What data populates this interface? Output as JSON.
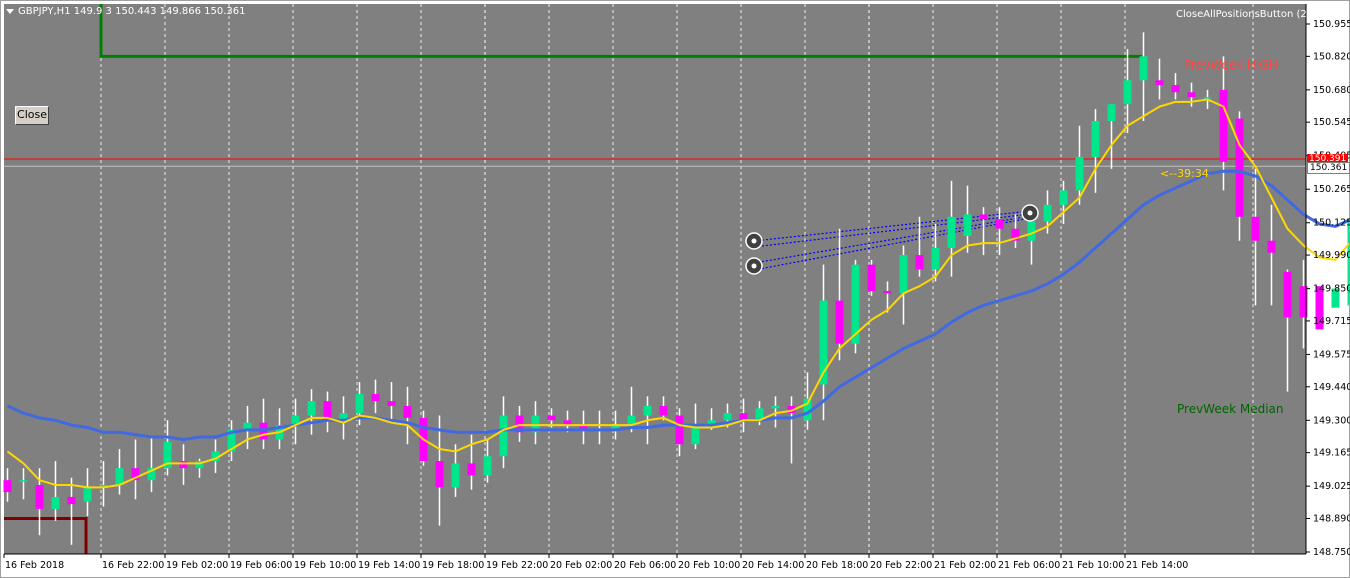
{
  "symbol_header": "GBPJPY,H1  149.9 3 150.443 149.866 150.361",
  "close_button": "Close",
  "close_all_button": "CloseAllPositionsButton (2)",
  "smiley_icon": "smiley-icon",
  "prev_week_high_label": "PrevWeek HIGH",
  "prev_week_median_label": "PrevWeek Median",
  "countdown_label": "<--39:34",
  "current_price_label": "150.361",
  "red_line_price_label": "150.391",
  "colors": {
    "background": "#808080",
    "bull": "#00e68c",
    "bear": "#ff00ff",
    "ma_fast": "#ffd700",
    "ma_slow": "#4169e1",
    "prev_high_line": "#008000",
    "prev_low_line": "#800000",
    "red_line": "#ff0000",
    "current_line": "#c0c0c0",
    "trend_lines": "#0000ff",
    "prev_high_text": "#ff4444",
    "median_text": "#006400",
    "countdown_text": "#ffd700"
  },
  "chart_data": {
    "type": "candlestick",
    "y_ticks": [
      "150.955",
      "150.820",
      "150.680",
      "150.545",
      "150.405",
      "150.265",
      "150.125",
      "149.990",
      "149.850",
      "149.715",
      "149.575",
      "149.440",
      "149.300",
      "149.165",
      "149.025",
      "148.890",
      "148.750"
    ],
    "x_ticks": [
      "16 Feb 2018",
      "16 Feb 22:00",
      "19 Feb 02:00",
      "19 Feb 06:00",
      "19 Feb 10:00",
      "19 Feb 14:00",
      "19 Feb 18:00",
      "19 Feb 22:00",
      "20 Feb 02:00",
      "20 Feb 06:00",
      "20 Feb 10:00",
      "20 Feb 14:00",
      "20 Feb 18:00",
      "20 Feb 22:00",
      "21 Feb 02:00",
      "21 Feb 06:00",
      "21 Feb 10:00",
      "21 Feb 14:00"
    ],
    "ylim": [
      148.75,
      150.98
    ],
    "prev_week_high": 150.82,
    "prev_week_low": 148.89,
    "red_line": 150.391,
    "current_price": 150.361,
    "candles": [
      [
        149.05,
        149.1,
        148.96,
        149.0
      ],
      [
        149.05,
        149.1,
        148.97,
        149.05
      ],
      [
        149.03,
        149.1,
        148.82,
        148.93
      ],
      [
        148.93,
        149.13,
        148.88,
        148.98
      ],
      [
        148.98,
        149.06,
        148.78,
        148.95
      ],
      [
        148.96,
        149.1,
        148.9,
        149.02
      ],
      [
        149.02,
        149.13,
        148.94,
        149.03
      ],
      [
        149.03,
        149.18,
        148.99,
        149.1
      ],
      [
        149.1,
        149.22,
        148.97,
        149.05
      ],
      [
        149.05,
        149.23,
        149.0,
        149.1
      ],
      [
        149.1,
        149.3,
        149.07,
        149.21
      ],
      [
        149.13,
        149.2,
        149.03,
        149.1
      ],
      [
        149.1,
        149.14,
        149.06,
        149.13
      ],
      [
        149.13,
        149.22,
        149.08,
        149.17
      ],
      [
        149.17,
        149.3,
        149.13,
        149.26
      ],
      [
        149.26,
        149.36,
        149.18,
        149.29
      ],
      [
        149.29,
        149.39,
        149.18,
        149.22
      ],
      [
        149.22,
        149.35,
        149.18,
        149.28
      ],
      [
        149.28,
        149.39,
        149.2,
        149.32
      ],
      [
        149.32,
        149.43,
        149.24,
        149.38
      ],
      [
        149.38,
        149.42,
        149.25,
        149.3
      ],
      [
        149.3,
        149.4,
        149.22,
        149.33
      ],
      [
        149.33,
        149.46,
        149.28,
        149.41
      ],
      [
        149.41,
        149.47,
        149.33,
        149.38
      ],
      [
        149.38,
        149.46,
        149.3,
        149.36
      ],
      [
        149.36,
        149.44,
        149.2,
        149.31
      ],
      [
        149.31,
        149.34,
        149.11,
        149.13
      ],
      [
        149.13,
        149.32,
        148.86,
        149.02
      ],
      [
        149.02,
        149.2,
        148.98,
        149.12
      ],
      [
        149.12,
        149.24,
        149.01,
        149.07
      ],
      [
        149.07,
        149.22,
        149.04,
        149.15
      ],
      [
        149.15,
        149.4,
        149.1,
        149.32
      ],
      [
        149.32,
        149.36,
        149.21,
        149.25
      ],
      [
        149.25,
        149.38,
        149.2,
        149.32
      ],
      [
        149.32,
        149.35,
        149.27,
        149.3
      ],
      [
        149.3,
        149.34,
        149.25,
        149.28
      ],
      [
        149.28,
        149.34,
        149.2,
        149.26
      ],
      [
        149.26,
        149.34,
        149.2,
        149.26
      ],
      [
        149.26,
        149.34,
        149.22,
        149.28
      ],
      [
        149.28,
        149.44,
        149.25,
        149.32
      ],
      [
        149.32,
        149.4,
        149.2,
        149.36
      ],
      [
        149.36,
        149.4,
        149.3,
        149.32
      ],
      [
        149.32,
        149.35,
        149.15,
        149.2
      ],
      [
        149.2,
        149.37,
        149.18,
        149.27
      ],
      [
        149.27,
        149.35,
        149.26,
        149.3
      ],
      [
        149.3,
        149.37,
        149.27,
        149.33
      ],
      [
        149.33,
        149.39,
        149.25,
        149.3
      ],
      [
        149.3,
        149.38,
        149.28,
        149.35
      ],
      [
        149.35,
        149.4,
        149.27,
        149.36
      ],
      [
        149.36,
        149.4,
        149.12,
        149.33
      ],
      [
        149.3,
        149.5,
        149.26,
        149.39
      ],
      [
        149.45,
        149.95,
        149.3,
        149.8
      ],
      [
        149.8,
        150.1,
        149.55,
        149.62
      ],
      [
        149.62,
        149.97,
        149.58,
        149.95
      ],
      [
        149.95,
        149.97,
        149.82,
        149.84
      ],
      [
        149.84,
        149.88,
        149.75,
        149.83
      ],
      [
        149.83,
        150.03,
        149.7,
        149.99
      ],
      [
        149.99,
        150.15,
        149.9,
        149.93
      ],
      [
        149.93,
        150.12,
        149.88,
        150.02
      ],
      [
        150.02,
        150.3,
        149.9,
        150.15
      ],
      [
        150.07,
        150.28,
        150.0,
        150.16
      ],
      [
        150.16,
        150.19,
        149.99,
        150.14
      ],
      [
        150.14,
        150.19,
        149.99,
        150.1
      ],
      [
        150.1,
        150.16,
        150.02,
        150.05
      ],
      [
        150.05,
        150.18,
        149.95,
        150.13
      ],
      [
        150.13,
        150.26,
        150.08,
        150.2
      ],
      [
        150.2,
        150.3,
        150.12,
        150.26
      ],
      [
        150.26,
        150.53,
        150.2,
        150.4
      ],
      [
        150.4,
        150.6,
        150.25,
        150.55
      ],
      [
        150.55,
        150.62,
        150.35,
        150.62
      ],
      [
        150.62,
        150.85,
        150.5,
        150.72
      ],
      [
        150.72,
        150.92,
        150.55,
        150.82
      ],
      [
        150.72,
        150.81,
        150.64,
        150.7
      ],
      [
        150.7,
        150.75,
        150.64,
        150.67
      ],
      [
        150.67,
        150.71,
        150.61,
        150.65
      ],
      [
        150.65,
        150.68,
        150.6,
        150.65
      ],
      [
        150.68,
        150.82,
        150.26,
        150.38
      ],
      [
        150.56,
        150.59,
        150.05,
        150.15
      ],
      [
        150.15,
        150.35,
        149.78,
        150.05
      ],
      [
        150.05,
        150.2,
        149.78,
        150.0
      ],
      [
        149.92,
        149.93,
        149.42,
        149.73
      ],
      [
        149.86,
        149.97,
        149.6,
        149.73
      ],
      [
        149.86,
        149.89,
        149.6,
        149.68
      ],
      [
        149.77,
        149.9,
        149.65,
        149.85
      ],
      [
        149.78,
        150.4,
        149.68,
        150.14
      ]
    ],
    "ma_fast": [
      149.17,
      149.12,
      149.05,
      149.03,
      149.03,
      149.02,
      149.02,
      149.03,
      149.06,
      149.09,
      149.12,
      149.12,
      149.12,
      149.14,
      149.18,
      149.22,
      149.24,
      149.25,
      149.28,
      149.31,
      149.31,
      149.29,
      149.32,
      149.31,
      149.29,
      149.28,
      149.22,
      149.18,
      149.17,
      149.2,
      149.22,
      149.26,
      149.28,
      149.28,
      149.28,
      149.28,
      149.28,
      149.28,
      149.28,
      149.28,
      149.3,
      149.31,
      149.28,
      149.27,
      149.27,
      149.28,
      149.3,
      149.3,
      149.33,
      149.34,
      149.37,
      149.5,
      149.6,
      149.66,
      149.72,
      149.76,
      149.83,
      149.86,
      149.9,
      149.99,
      150.03,
      150.04,
      150.04,
      150.06,
      150.08,
      150.11,
      150.17,
      150.23,
      150.35,
      150.45,
      150.53,
      150.57,
      150.61,
      150.63,
      150.63,
      150.64,
      150.61,
      150.45,
      150.36,
      150.23,
      150.1,
      150.03,
      149.98,
      149.97,
      150.05
    ],
    "ma_slow": [
      149.36,
      149.33,
      149.31,
      149.3,
      149.28,
      149.27,
      149.25,
      149.25,
      149.24,
      149.23,
      149.23,
      149.22,
      149.23,
      149.23,
      149.25,
      149.26,
      149.26,
      149.27,
      149.28,
      149.29,
      149.3,
      149.3,
      149.31,
      149.31,
      149.3,
      149.29,
      149.27,
      149.26,
      149.25,
      149.25,
      149.25,
      149.26,
      149.26,
      149.26,
      149.26,
      149.26,
      149.26,
      149.26,
      149.26,
      149.27,
      149.27,
      149.28,
      149.28,
      149.28,
      149.28,
      149.29,
      149.3,
      149.3,
      149.31,
      149.31,
      149.33,
      149.38,
      149.44,
      149.48,
      149.52,
      149.56,
      149.6,
      149.63,
      149.66,
      149.71,
      149.75,
      149.78,
      149.8,
      149.82,
      149.84,
      149.87,
      149.91,
      149.96,
      150.02,
      150.08,
      150.14,
      150.2,
      150.24,
      150.27,
      150.3,
      150.33,
      150.34,
      150.34,
      150.32,
      150.28,
      150.22,
      150.16,
      150.12,
      150.11,
      150.14
    ]
  }
}
